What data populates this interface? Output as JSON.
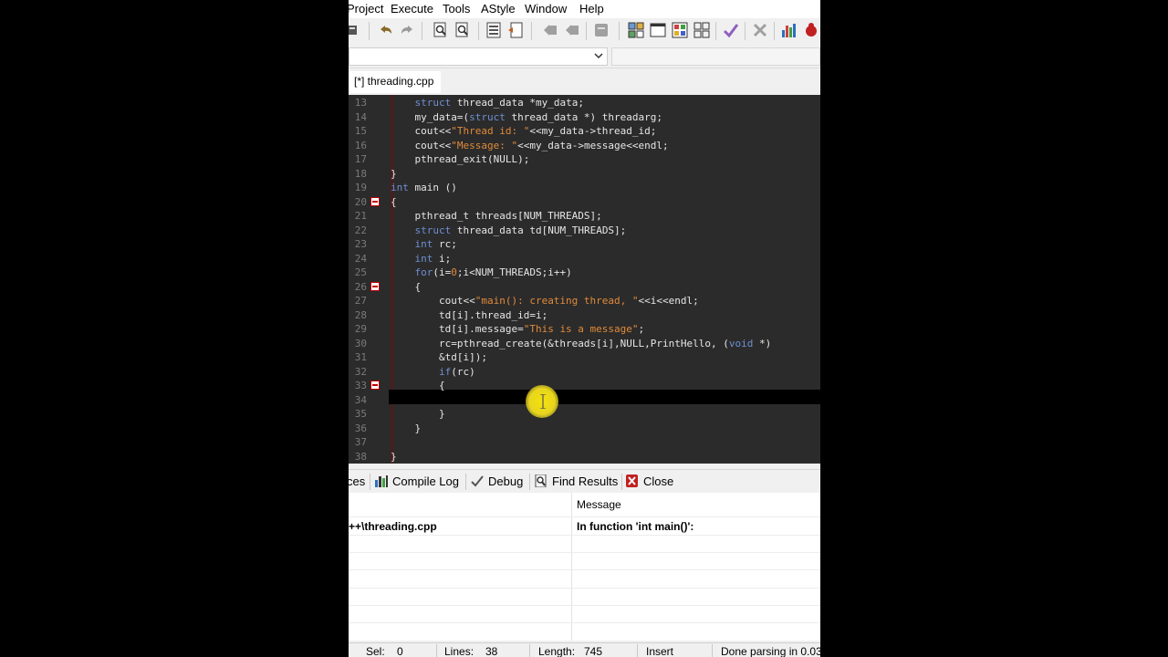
{
  "menu": [
    "Project",
    "Execute",
    "Tools",
    "AStyle",
    "Window",
    "Help"
  ],
  "file_tab": "[*] threading.cpp",
  "code_lines": [
    {
      "n": "13",
      "segs": [
        [
          "    ",
          ""
        ],
        [
          "struct",
          "kw"
        ],
        [
          " thread_data *my_data;",
          ""
        ]
      ]
    },
    {
      "n": "14",
      "segs": [
        [
          "    my_data=(",
          ""
        ],
        [
          "struct",
          "kw"
        ],
        [
          " thread_data *) threadarg;",
          ""
        ]
      ]
    },
    {
      "n": "15",
      "segs": [
        [
          "    cout<<",
          ""
        ],
        [
          "\"Thread id: \"",
          "str"
        ],
        [
          "<<my_data->thread_id;",
          ""
        ]
      ]
    },
    {
      "n": "16",
      "segs": [
        [
          "    cout<<",
          ""
        ],
        [
          "\"Message: \"",
          "str"
        ],
        [
          "<<my_data->message<<endl;",
          ""
        ]
      ]
    },
    {
      "n": "17",
      "segs": [
        [
          "    pthread_exit(NULL);",
          ""
        ]
      ]
    },
    {
      "n": "18",
      "segs": [
        [
          "}",
          ""
        ]
      ]
    },
    {
      "n": "19",
      "segs": [
        [
          "int",
          "kw"
        ],
        [
          " main ()",
          ""
        ]
      ]
    },
    {
      "n": "20",
      "segs": [
        [
          "{",
          ""
        ]
      ]
    },
    {
      "n": "21",
      "segs": [
        [
          "    pthread_t threads[NUM_THREADS];",
          ""
        ]
      ]
    },
    {
      "n": "22",
      "segs": [
        [
          "    ",
          ""
        ],
        [
          "struct",
          "kw"
        ],
        [
          " thread_data td[NUM_THREADS];",
          ""
        ]
      ]
    },
    {
      "n": "23",
      "segs": [
        [
          "    ",
          ""
        ],
        [
          "int",
          "kw"
        ],
        [
          " rc;",
          ""
        ]
      ]
    },
    {
      "n": "24",
      "segs": [
        [
          "    ",
          ""
        ],
        [
          "int",
          "kw"
        ],
        [
          " i;",
          ""
        ]
      ]
    },
    {
      "n": "25",
      "segs": [
        [
          "    ",
          ""
        ],
        [
          "for",
          "kw"
        ],
        [
          "(i=",
          ""
        ],
        [
          "0",
          "num"
        ],
        [
          ";i<NUM_THREADS;i++)",
          ""
        ]
      ]
    },
    {
      "n": "26",
      "segs": [
        [
          "    {",
          ""
        ]
      ]
    },
    {
      "n": "27",
      "segs": [
        [
          "        cout<<",
          ""
        ],
        [
          "\"main(): creating thread, \"",
          "str"
        ],
        [
          "<<i<<endl;",
          ""
        ]
      ]
    },
    {
      "n": "28",
      "segs": [
        [
          "        td[i].thread_id=i;",
          ""
        ]
      ]
    },
    {
      "n": "29",
      "segs": [
        [
          "        td[i].message=",
          ""
        ],
        [
          "\"This is a message\"",
          "str"
        ],
        [
          ";",
          ""
        ]
      ]
    },
    {
      "n": "30",
      "segs": [
        [
          "        rc=pthread_create(&threads[i],NULL,PrintHello, (",
          ""
        ],
        [
          "void",
          "kw"
        ],
        [
          " *)",
          ""
        ]
      ]
    },
    {
      "n": "31",
      "segs": [
        [
          "        &td[i]);",
          ""
        ]
      ]
    },
    {
      "n": "32",
      "segs": [
        [
          "        ",
          ""
        ],
        [
          "if",
          "kw"
        ],
        [
          "(rc)",
          ""
        ]
      ]
    },
    {
      "n": "33",
      "segs": [
        [
          "        {",
          ""
        ]
      ]
    },
    {
      "n": "34",
      "segs": [
        [
          "",
          ""
        ]
      ]
    },
    {
      "n": "35",
      "segs": [
        [
          "        }",
          ""
        ]
      ]
    },
    {
      "n": "36",
      "segs": [
        [
          "    }",
          ""
        ]
      ]
    },
    {
      "n": "37",
      "segs": [
        [
          "",
          ""
        ]
      ]
    },
    {
      "n": "38",
      "segs": [
        [
          "}",
          ""
        ]
      ]
    }
  ],
  "folds": [
    "20",
    "26",
    "33"
  ],
  "bottom_tabs": [
    "ces",
    "Compile Log",
    "Debug",
    "Find Results",
    "Close"
  ],
  "log": {
    "message_header": "Message",
    "rows": [
      {
        "file": "++\\threading.cpp",
        "message": "In function 'int main()':"
      }
    ]
  },
  "status": {
    "sel_label": "Sel:",
    "sel_value": "0",
    "lines_label": "Lines:",
    "lines_value": "38",
    "length_label": "Length:",
    "length_value": "745",
    "mode": "Insert",
    "parse": "Done parsing in 0.03"
  }
}
